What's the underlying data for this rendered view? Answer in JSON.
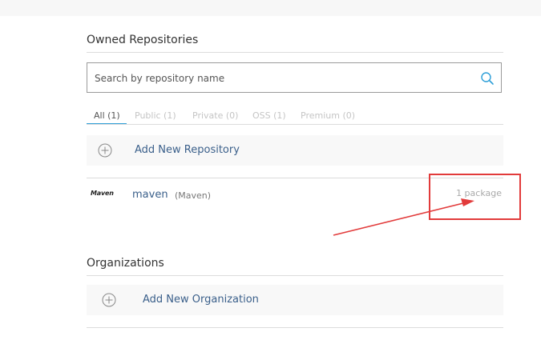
{
  "owned": {
    "title": "Owned Repositories",
    "search": {
      "placeholder": "Search by repository name",
      "icon": "search-icon"
    },
    "tabs": [
      {
        "label": "All (1)",
        "active": true
      },
      {
        "label": "Public (1)",
        "active": false
      },
      {
        "label": "Private (0)",
        "active": false
      },
      {
        "label": "OSS (1)",
        "active": false
      },
      {
        "label": "Premium (0)",
        "active": false
      }
    ],
    "add_label": "Add New Repository",
    "repos": [
      {
        "logo_text": "Maven",
        "name": "maven",
        "type": "(Maven)",
        "count": "1 package"
      }
    ]
  },
  "organizations": {
    "title": "Organizations",
    "add_label": "Add New Organization"
  },
  "colors": {
    "accent": "#2e9fd8",
    "link": "#3a5f8a",
    "annotation": "#e23b3b"
  }
}
